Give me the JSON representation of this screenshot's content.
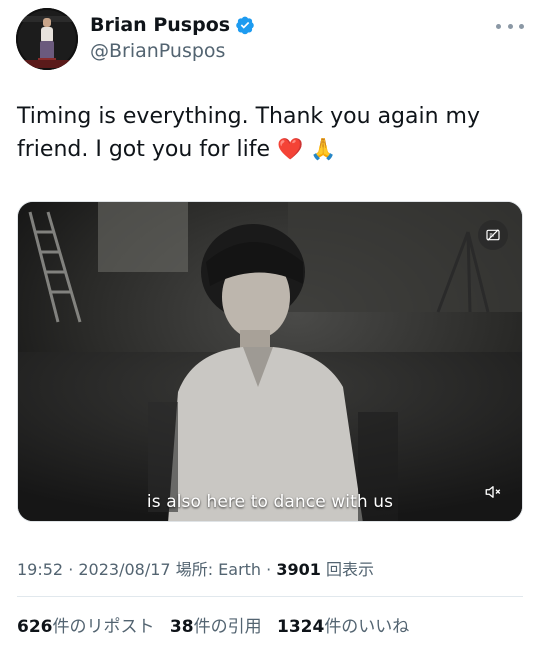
{
  "author": {
    "name": "Brian Puspos",
    "handle": "@BrianPuspos",
    "verified": true,
    "verified_color": "#1d9bf0"
  },
  "tweet": {
    "text": "Timing is everything. Thank you again my friend. I got you for life",
    "emojis": [
      "❤️",
      "🙏"
    ]
  },
  "media": {
    "type": "video",
    "subtitle": "is also here to dance with us",
    "icons": [
      "captions-off-icon",
      "mute-icon"
    ]
  },
  "meta": {
    "time": "19:52",
    "date": "2023/08/17",
    "location_label": "場所: Earth",
    "views_count": "3901",
    "views_label": "回表示"
  },
  "stats": {
    "reposts_count": "626",
    "reposts_label": "件のリポスト",
    "quotes_count": "38",
    "quotes_label": "件の引用",
    "likes_count": "1324",
    "likes_label": "件のいいね"
  },
  "colors": {
    "text_primary": "#0f1419",
    "text_secondary": "#536471",
    "accent": "#1d9bf0"
  }
}
